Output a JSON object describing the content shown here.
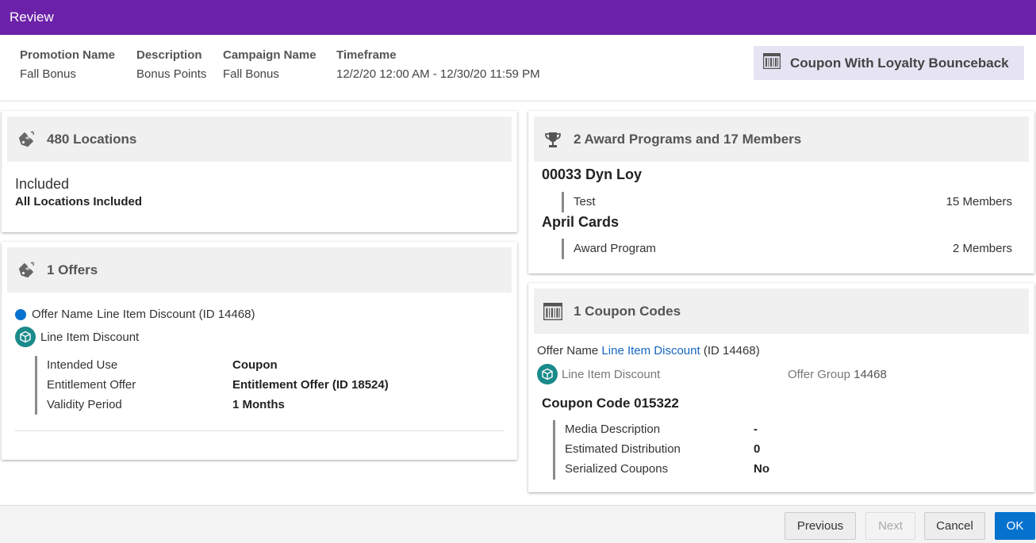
{
  "window": {
    "title": "Review"
  },
  "summary": {
    "promotion_name_label": "Promotion Name",
    "promotion_name": "Fall Bonus",
    "description_label": "Description",
    "description": "Bonus Points",
    "campaign_name_label": "Campaign Name",
    "campaign_name": "Fall Bonus",
    "timeframe_label": "Timeframe",
    "timeframe": "12/2/20 12:00 AM - 12/30/20 11:59 PM",
    "promotion_type": "Coupon With Loyalty Bounceback"
  },
  "locations": {
    "title": "480 Locations",
    "status": "Included",
    "detail": "All Locations Included"
  },
  "offers": {
    "title": "1 Offers",
    "offer_name_label": "Offer Name",
    "offer_name": "Line Item Discount (ID 14468)",
    "item_name": "Line Item Discount",
    "details": [
      {
        "label": "Intended Use",
        "value": "Coupon"
      },
      {
        "label": "Entitlement Offer",
        "value": "Entitlement Offer (ID 18524)"
      },
      {
        "label": "Validity Period",
        "value": "1 Months"
      }
    ]
  },
  "awards": {
    "title": "2 Award Programs and 17 Members",
    "programs": [
      {
        "name": "00033 Dyn Loy",
        "sub": "Test",
        "members": "15 Members"
      },
      {
        "name": "April Cards",
        "sub": "Award Program",
        "members": "2 Members"
      }
    ]
  },
  "coupons": {
    "title": "1 Coupon Codes",
    "offer_name_label": "Offer Name",
    "offer_link": "Line Item Discount",
    "offer_id": "(ID 14468)",
    "item_name": "Line Item Discount",
    "offer_group_label": "Offer Group",
    "offer_group_value": "14468",
    "coupon_code": "Coupon Code 015322",
    "details": [
      {
        "label": "Media Description",
        "value": "-"
      },
      {
        "label": "Estimated Distribution",
        "value": "0"
      },
      {
        "label": "Serialized Coupons",
        "value": "No"
      }
    ]
  },
  "footer": {
    "previous": "Previous",
    "next": "Next",
    "cancel": "Cancel",
    "ok": "OK"
  },
  "colors": {
    "header": "#6b21a8",
    "primary_button": "#0572ce",
    "offer_dot": "#0572ce",
    "item_icon": "#1a8a8a"
  },
  "icons": {
    "type_badge": "barcode-icon",
    "locations": "price-tag-icon",
    "offers": "price-tag-icon",
    "awards": "trophy-icon",
    "coupons": "barcode-icon",
    "item": "cube-icon"
  }
}
